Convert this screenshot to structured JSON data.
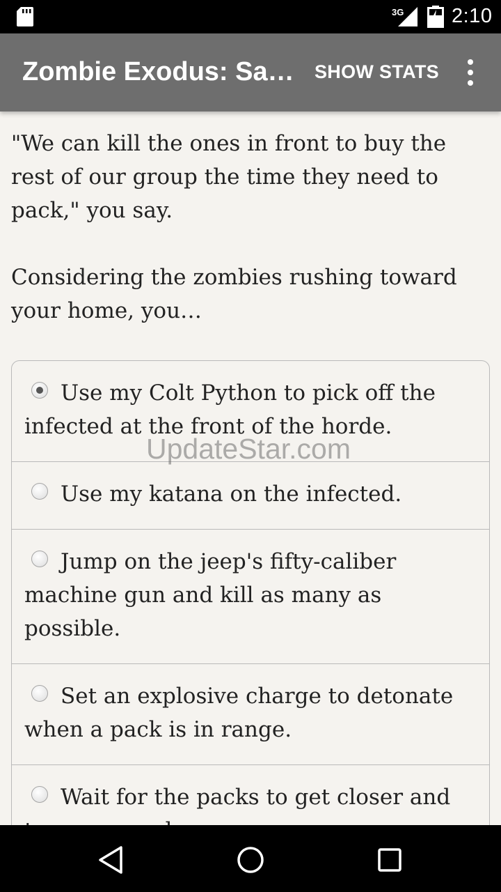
{
  "status_bar": {
    "network": "3G",
    "time": "2:10",
    "icons": [
      "sd-card-icon",
      "signal-icon",
      "battery-icon"
    ]
  },
  "app_bar": {
    "title": "Zombie Exodus: Safe Haven",
    "action_label": "SHOW STATS",
    "menu_icon": "overflow-menu-icon"
  },
  "story": {
    "paragraphs": [
      "\"We can kill the ones in front to buy the rest of our group the time they need to pack,\" you say.",
      "Considering the zombies rushing toward your home, you…"
    ]
  },
  "choices": [
    {
      "label": "Use my Colt Python to pick off the infected at the front of the horde.",
      "selected": true
    },
    {
      "label": "Use my katana on the infected.",
      "selected": false
    },
    {
      "label": "Jump on the jeep's fifty-caliber machine gun and kill as many as possible.",
      "selected": false
    },
    {
      "label": "Set an explosive charge to detonate when a pack is in range.",
      "selected": false
    },
    {
      "label": "Wait for the packs to get closer and toss a grenade.",
      "selected": false
    }
  ],
  "watermark": "UpdateStar.com",
  "nav_bar": {
    "buttons": [
      "back-icon",
      "home-icon",
      "recents-icon"
    ]
  },
  "colors": {
    "app_bar": "#6e6e6e",
    "background": "#f5f3ef",
    "divider": "#b9b9b9"
  }
}
